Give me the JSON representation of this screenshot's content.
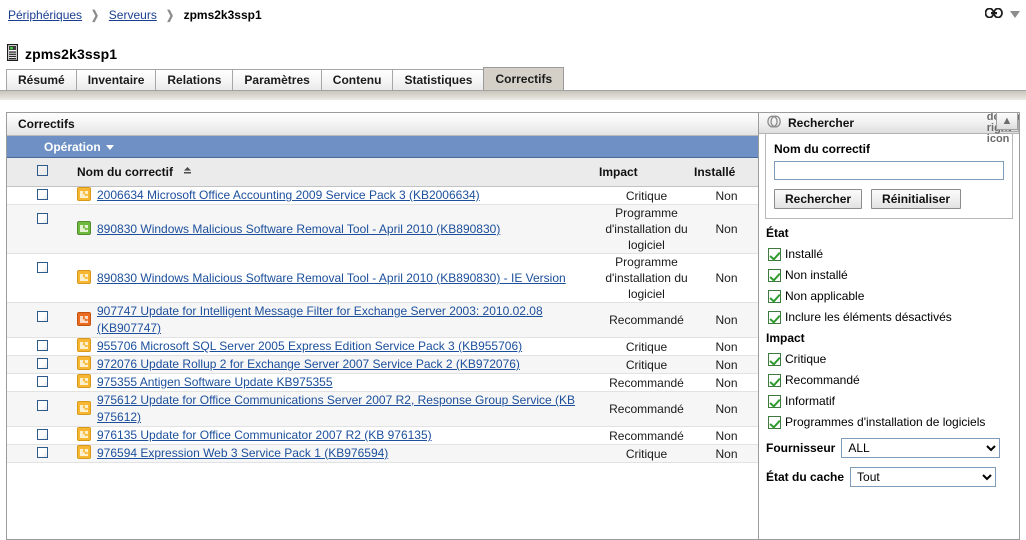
{
  "breadcrumb": {
    "items": [
      {
        "label": "Périphériques",
        "link": true
      },
      {
        "label": "Serveurs",
        "link": true
      },
      {
        "label": "zpms2k3ssp1",
        "link": false
      }
    ],
    "separator": "❯"
  },
  "topbar": {
    "link_icon": "chain-link-icon",
    "dropdown_icon": "caret-down-icon"
  },
  "device": {
    "icon": "server-device-icon",
    "name": "zpms2k3ssp1"
  },
  "tabs": [
    {
      "label": "Résumé",
      "active": false
    },
    {
      "label": "Inventaire",
      "active": false
    },
    {
      "label": "Relations",
      "active": false
    },
    {
      "label": "Paramètres",
      "active": false
    },
    {
      "label": "Contenu",
      "active": false
    },
    {
      "label": "Statistiques",
      "active": false
    },
    {
      "label": "Correctifs",
      "active": true
    }
  ],
  "patches_panel": {
    "title": "Correctifs",
    "operation_label": "Opération",
    "columns": {
      "name": "Nom du correctif",
      "impact": "Impact",
      "installed": "Installé",
      "sort_indicator": "▲"
    },
    "rows": [
      {
        "icon": "patch-icon-orange",
        "name": "2006634 Microsoft Office Accounting 2009 Service Pack 3 (KB2006634)",
        "impact": "Critique",
        "installed": "Non"
      },
      {
        "icon": "patch-icon-green",
        "name": "890830 Windows Malicious Software Removal Tool - April 2010 (KB890830)",
        "impact": "Programme d'installation du logiciel",
        "installed": "Non"
      },
      {
        "icon": "patch-icon-orange",
        "name": "890830 Windows Malicious Software Removal Tool - April 2010 (KB890830) - IE Version",
        "impact": "Programme d'installation du logiciel",
        "installed": "Non"
      },
      {
        "icon": "patch-icon-red",
        "name": "907747 Update for Intelligent Message Filter for Exchange Server 2003: 2010.02.08 (KB907747)",
        "impact": "Recommandé",
        "installed": "Non"
      },
      {
        "icon": "patch-icon-orange",
        "name": "955706 Microsoft SQL Server 2005 Express Edition Service Pack 3 (KB955706)",
        "impact": "Critique",
        "installed": "Non"
      },
      {
        "icon": "patch-icon-orange",
        "name": "972076 Update Rollup 2 for Exchange Server 2007 Service Pack 2 (KB972076)",
        "impact": "Critique",
        "installed": "Non"
      },
      {
        "icon": "patch-icon-orange",
        "name": "975355 Antigen Software Update KB975355",
        "impact": "Recommandé",
        "installed": "Non"
      },
      {
        "icon": "patch-icon-orange",
        "name": "975612 Update for Office Communications Server 2007 R2, Response Group Service (KB 975612)",
        "impact": "Recommandé",
        "installed": "Non"
      },
      {
        "icon": "patch-icon-orange",
        "name": "976135 Update for Office Communicator 2007 R2 (KB 976135)",
        "impact": "Recommandé",
        "installed": "Non"
      },
      {
        "icon": "patch-icon-orange",
        "name": "976594 Expression Web 3 Service Pack 1 (KB976594)",
        "impact": "Critique",
        "installed": "Non"
      }
    ]
  },
  "search_panel": {
    "header_icon": "search-rings-icon",
    "header_title": "Rechercher",
    "expand_icon": "chevron-double-right-icon",
    "field_label": "Nom du correctif",
    "field_value": "",
    "field_placeholder": "",
    "search_button": "Rechercher",
    "reset_button": "Réinitialiser",
    "state_group_title": "État",
    "state_options": [
      {
        "label": "Installé",
        "checked": true
      },
      {
        "label": "Non installé",
        "checked": true
      },
      {
        "label": "Non applicable",
        "checked": true
      },
      {
        "label": "Inclure les éléments désactivés",
        "checked": true
      }
    ],
    "impact_group_title": "Impact",
    "impact_options": [
      {
        "label": "Critique",
        "checked": true
      },
      {
        "label": "Recommandé",
        "checked": true
      },
      {
        "label": "Informatif",
        "checked": true
      },
      {
        "label": "Programmes d'installation de logiciels",
        "checked": true
      }
    ],
    "vendor_label": "Fournisseur",
    "vendor_value": "ALL",
    "vendor_options": [
      "ALL"
    ],
    "cache_label": "État du cache",
    "cache_value": "Tout",
    "cache_options": [
      "Tout"
    ]
  },
  "collapse_controls": {
    "collapse_up": "⌃",
    "expand_right": "»"
  },
  "colors": {
    "op_bar": "#6e90c4",
    "link": "#1c4f9c",
    "active_tab": "#d4d0c8",
    "check_green": "#2f9b2f",
    "patch_orange": "#f5a623",
    "patch_green": "#6ab04c",
    "patch_red": "#e8601c"
  }
}
